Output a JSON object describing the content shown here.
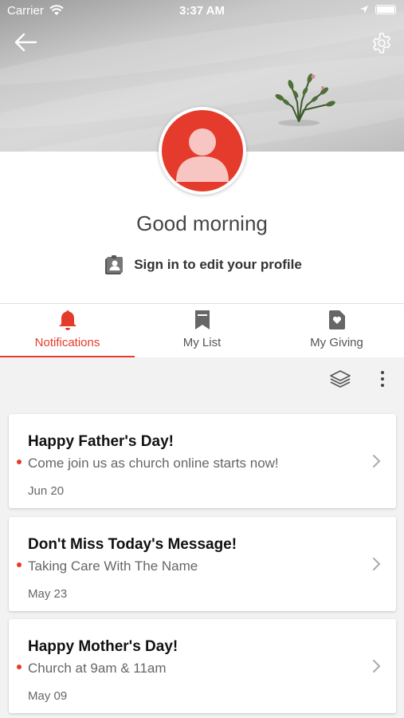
{
  "status_bar": {
    "carrier": "Carrier",
    "time": "3:37 AM"
  },
  "header": {
    "greeting": "Good morning",
    "signin_label": "Sign in to edit your profile"
  },
  "tabs": [
    {
      "label": "Notifications",
      "icon": "bell-icon",
      "active": true
    },
    {
      "label": "My List",
      "icon": "bookmark-icon",
      "active": false
    },
    {
      "label": "My Giving",
      "icon": "giving-icon",
      "active": false
    }
  ],
  "notifications": [
    {
      "title": "Happy Father's Day!",
      "subtitle": "Come join us as church online starts now!",
      "date": "Jun 20",
      "unread": true
    },
    {
      "title": "Don't Miss Today's Message!",
      "subtitle": "Taking Care With The Name",
      "date": "May 23",
      "unread": true
    },
    {
      "title": "Happy Mother's Day!",
      "subtitle": "Church at 9am & 11am",
      "date": "May 09",
      "unread": true
    }
  ],
  "colors": {
    "accent": "#e53b2c",
    "background": "#f2f2f2"
  }
}
